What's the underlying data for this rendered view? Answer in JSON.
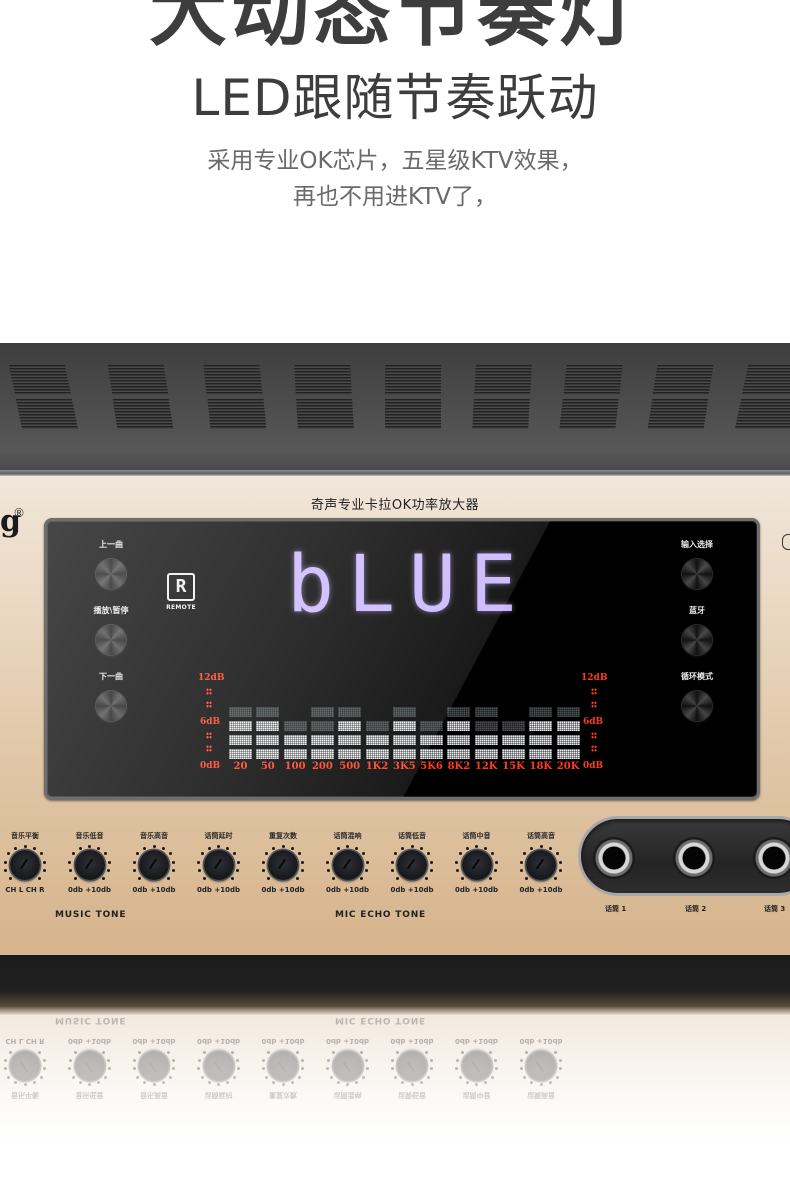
{
  "headline": "大动态节奏灯",
  "subtitle": "LED跟随节奏跃动",
  "description": {
    "line1": "采用专业OK芯片，五星级KTV效果，",
    "line2": "再也不用进KTV了，"
  },
  "device": {
    "brand_partial": "g",
    "registered_mark": "®",
    "front_title": "奇声专业卡拉OK功率放大器",
    "left_buttons": [
      {
        "label": "上一曲",
        "icon": "prev-track-icon"
      },
      {
        "label": "播放\\暂停",
        "icon": "play-pause-icon"
      },
      {
        "label": "下一曲",
        "icon": "next-track-icon"
      }
    ],
    "right_buttons": [
      {
        "label": "输入选择",
        "icon": "input-select-icon"
      },
      {
        "label": "蓝牙",
        "icon": "bluetooth-icon"
      },
      {
        "label": "循环模式",
        "icon": "loop-mode-icon"
      }
    ],
    "remote_badge": {
      "glyph": "R",
      "label": "REMOTE"
    },
    "display_text": "bLUE",
    "display_color": "#c9b6ff",
    "eq": {
      "db_labels": [
        "12dB",
        "6dB",
        "0dB"
      ],
      "bands": [
        "20",
        "50",
        "100",
        "200",
        "500",
        "1K2",
        "3K5",
        "5K6",
        "8K2",
        "12K",
        "15K",
        "18K",
        "20K"
      ],
      "lit_levels": [
        3,
        3,
        2,
        2,
        3,
        2,
        3,
        2,
        3,
        2,
        2,
        3,
        3
      ],
      "dim_levels": [
        4,
        4,
        3,
        4,
        4,
        3,
        4,
        3,
        4,
        4,
        3,
        4,
        4
      ],
      "accent_color": "#ff3b1e"
    },
    "knobs": [
      {
        "name": "音乐平衡",
        "range": "CH L  CH R"
      },
      {
        "name": "音乐低音",
        "range": "0db  +10db"
      },
      {
        "name": "音乐高音",
        "range": "0db  +10db"
      },
      {
        "name": "话筒延时",
        "range": "0db  +10db"
      },
      {
        "name": "重复次数",
        "range": "0db  +10db"
      },
      {
        "name": "话筒混响",
        "range": "0db  +10db"
      },
      {
        "name": "话筒低音",
        "range": "0db  +10db"
      },
      {
        "name": "话筒中音",
        "range": "0db  +10db"
      },
      {
        "name": "话筒高音",
        "range": "0db  +10db"
      }
    ],
    "group_labels": {
      "music": "MUSIC TONE",
      "mic": "MIC ECHO TONE"
    },
    "mic_jacks": [
      "话筒 1",
      "话筒 2",
      "话筒 3"
    ]
  }
}
